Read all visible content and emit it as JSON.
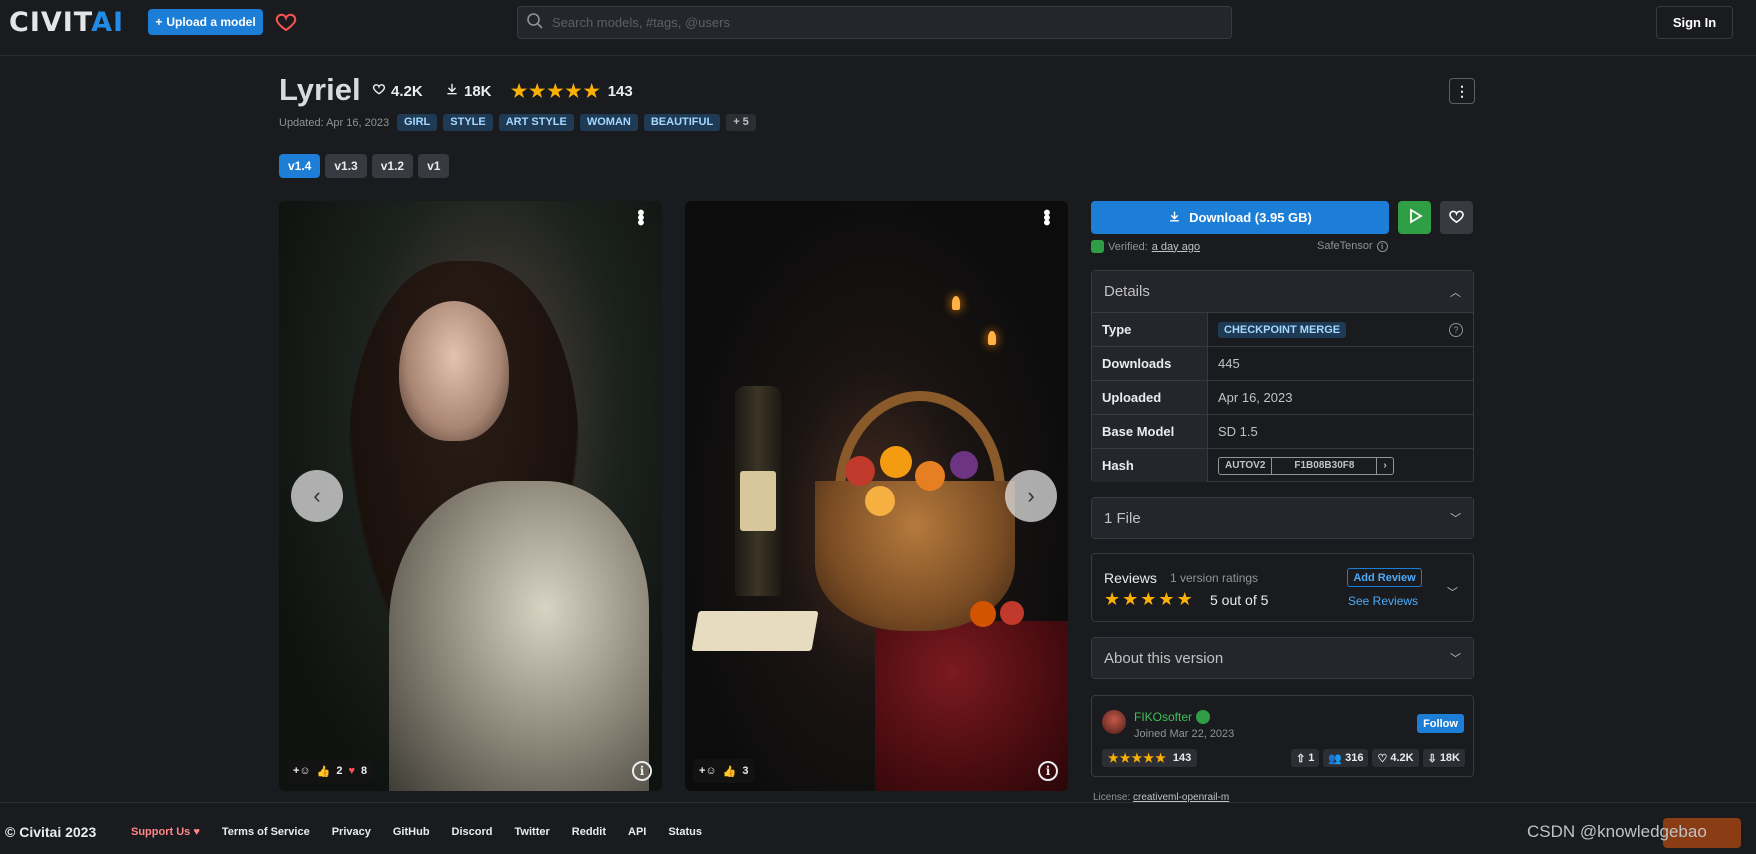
{
  "header": {
    "logo_main": "CIVIT",
    "logo_accent": "AI",
    "upload_label": "Upload a model",
    "search_placeholder": "Search models, #tags, @users",
    "signin_label": "Sign In"
  },
  "model": {
    "title": "Lyriel",
    "likes": "4.2K",
    "downloads": "18K",
    "rating_count": "143",
    "rating_stars": 5,
    "updated": "Updated: Apr 16, 2023",
    "tags": [
      "GIRL",
      "STYLE",
      "ART STYLE",
      "WOMAN",
      "BEAUTIFUL"
    ],
    "more_tags": "+ 5",
    "versions": [
      "v1.4",
      "v1.3",
      "v1.2",
      "v1"
    ],
    "active_version": "v1.4"
  },
  "gallery": [
    {
      "reactions_thumbs": "2",
      "reactions_hearts": "8"
    },
    {
      "reactions_thumbs": "3"
    }
  ],
  "download": {
    "label": "Download (3.95 GB)",
    "verified_prefix": "Verified:",
    "verified_when": "a day ago",
    "format": "SafeTensor"
  },
  "details": {
    "title": "Details",
    "rows": {
      "type_label": "Type",
      "type_value": "CHECKPOINT MERGE",
      "downloads_label": "Downloads",
      "downloads_value": "445",
      "uploaded_label": "Uploaded",
      "uploaded_value": "Apr 16, 2023",
      "base_label": "Base Model",
      "base_value": "SD 1.5",
      "hash_label": "Hash",
      "hash_algo": "AUTOV2",
      "hash_value": "F1B08B30F8"
    }
  },
  "files": {
    "title": "1 File"
  },
  "reviews": {
    "title": "Reviews",
    "subtitle": "1 version ratings",
    "score": "5 out of 5",
    "add_label": "Add Review",
    "see_label": "See Reviews"
  },
  "about": {
    "title": "About this version"
  },
  "creator": {
    "name": "FIKOsofter",
    "joined": "Joined Mar 22, 2023",
    "follow_label": "Follow",
    "rating_count": "143",
    "uploads": "1",
    "followers": "316",
    "likes": "4.2K",
    "downloads": "18K"
  },
  "license": {
    "prefix": "License:",
    "name": "creativeml-openrail-m"
  },
  "footer": {
    "copyright": "© Civitai 2023",
    "links": [
      "Support Us",
      "Terms of Service",
      "Privacy",
      "GitHub",
      "Discord",
      "Twitter",
      "Reddit",
      "API",
      "Status"
    ]
  },
  "watermark": "CSDN @knowledgebao",
  "colors": {
    "accent": "#1c7ed6",
    "star": "#fab005",
    "success": "#2f9e44",
    "background": "#1a1b1e"
  }
}
